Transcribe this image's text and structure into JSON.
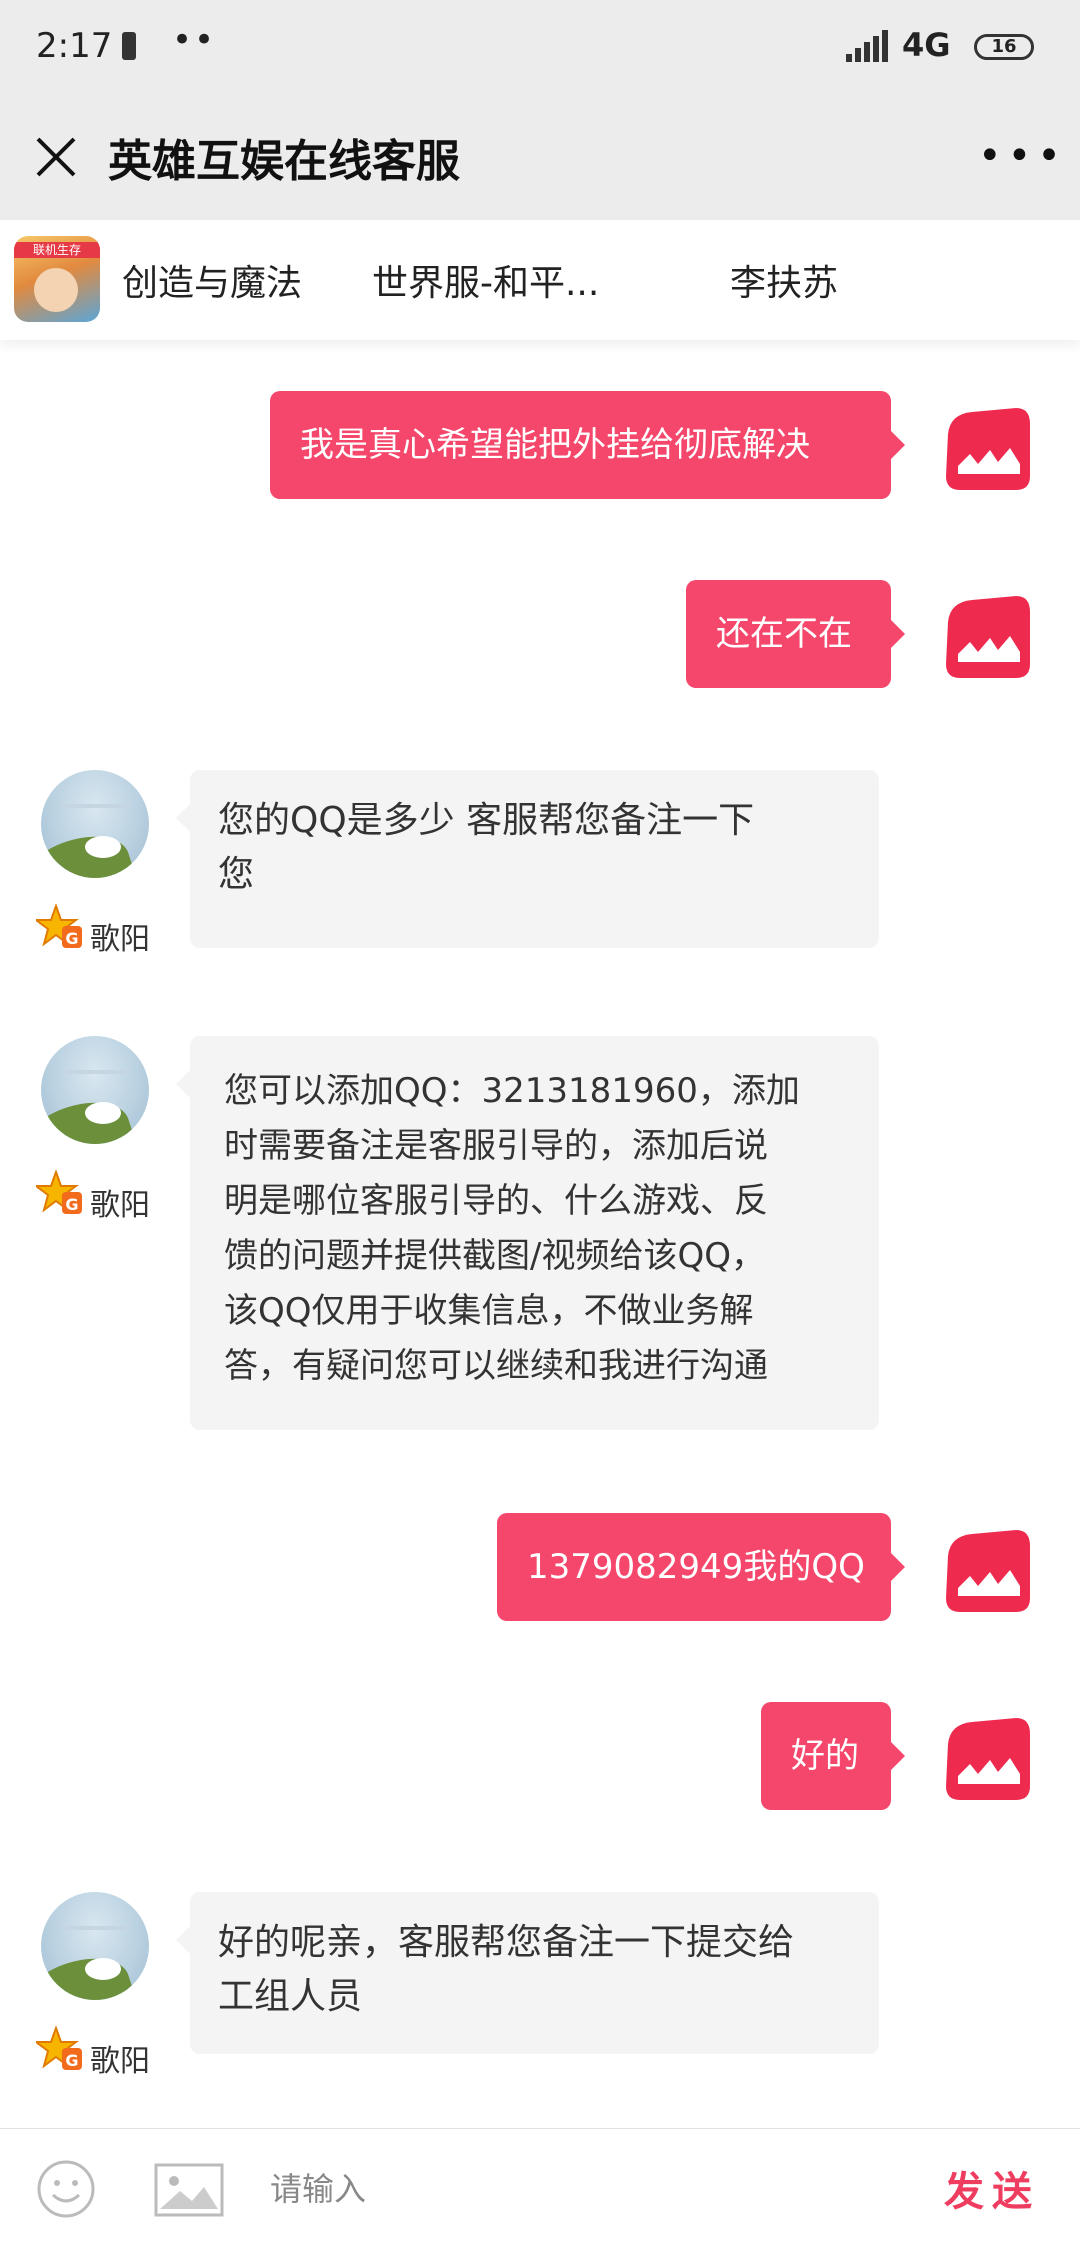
{
  "status_bar": {
    "time": "2:17",
    "network": "4G",
    "battery": "16"
  },
  "header": {
    "title": "英雄互娱在线客服"
  },
  "game_bar": {
    "icon_text": "联机生存",
    "tabs": [
      "创造与魔法",
      "世界服-和平...",
      "李扶苏"
    ]
  },
  "messages": [
    {
      "side": "right",
      "text": "我是真心希望能把外挂给彻底解决"
    },
    {
      "side": "right",
      "text": "还在不在"
    },
    {
      "side": "left",
      "agent": "歌阳",
      "lines": [
        "您的QQ是多少 客服帮您备注一下",
        "您"
      ]
    },
    {
      "side": "left",
      "agent": "歌阳",
      "lines": [
        "您可以添加QQ：3213181960，添加",
        "时需要备注是客服引导的，添加后说",
        "明是哪位客服引导的、什么游戏、反",
        "馈的问题并提供截图/视频给该QQ，",
        "该QQ仅用于收集信息，不做业务解",
        "答，有疑问您可以继续和我进行沟通"
      ]
    },
    {
      "side": "right",
      "text": "1379082949我的QQ"
    },
    {
      "side": "right",
      "text": "好的"
    },
    {
      "side": "left",
      "agent": "歌阳",
      "lines": [
        "好的呢亲，客服帮您备注一下提交给",
        "工组人员"
      ]
    }
  ],
  "input_bar": {
    "placeholder": "请输入",
    "send_label": "发送"
  },
  "colors": {
    "accent": "#f5476b",
    "send_text": "#ee3d5f",
    "header_bg": "#ececec",
    "agent_bubble": "#f4f4f4"
  }
}
